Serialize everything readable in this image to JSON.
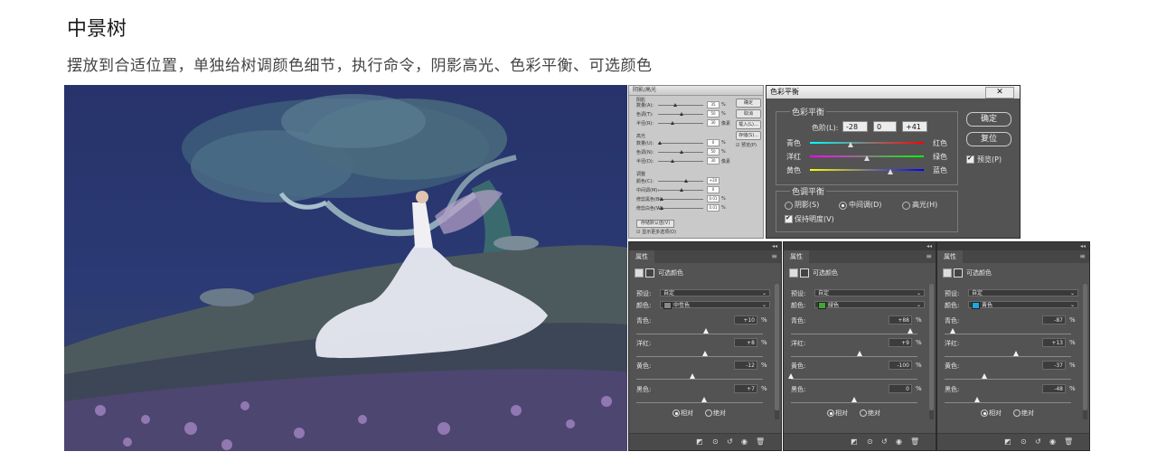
{
  "heading": "中景树",
  "description": "摆放到合适位置，单独给树调颜色细节，执行命令，阴影高光、色彩平衡、可选颜色",
  "shadows_highlights": {
    "title": "阴影/高光",
    "section_shadow": "阴影",
    "section_highlight": "高光",
    "section_adjust": "调整",
    "rows": [
      {
        "label": "数量(A):",
        "value": "35",
        "unit": "%"
      },
      {
        "label": "色调(T):",
        "value": "50",
        "unit": "%"
      },
      {
        "label": "半径(R):",
        "value": "30",
        "unit": "像素"
      },
      {
        "label": "数量(U):",
        "value": "0",
        "unit": "%"
      },
      {
        "label": "色调(N):",
        "value": "50",
        "unit": "%"
      },
      {
        "label": "半径(D):",
        "value": "30",
        "unit": "像素"
      },
      {
        "label": "颜色(C):",
        "value": "+20",
        "unit": ""
      },
      {
        "label": "中间调(M):",
        "value": "0",
        "unit": ""
      },
      {
        "label": "修剪黑色(B):",
        "value": "0.01",
        "unit": "%"
      },
      {
        "label": "修剪白色(W):",
        "value": "0.01",
        "unit": "%"
      }
    ],
    "buttons": [
      "确定",
      "取消",
      "载入(L)...",
      "存储(S)..."
    ],
    "preview_label": "预览(P)",
    "save_default": "存储默认值(V)",
    "more_options": "显示更多选项(O)"
  },
  "color_balance": {
    "window_title": "色彩平衡",
    "close_label": "✕",
    "group_title": "色彩平衡",
    "levels_label": "色阶(L):",
    "levels": [
      "-28",
      "0",
      "+41"
    ],
    "sliders": [
      {
        "left": "青色",
        "right": "红色",
        "value": -28
      },
      {
        "left": "洋红",
        "right": "绿色",
        "value": 0
      },
      {
        "left": "黄色",
        "right": "蓝色",
        "value": 41
      }
    ],
    "tone_title": "色调平衡",
    "tones": [
      "阴影(S)",
      "中间调(D)",
      "高光(H)"
    ],
    "tone_selected": 1,
    "preserve_label": "保持明度(V)",
    "ok_label": "确定",
    "reset_label": "复位",
    "preview_label": "预览(P)"
  },
  "properties_panels": [
    {
      "tab": "属性",
      "type_label": "可选颜色",
      "preset_label": "预设:",
      "preset_value": "自定",
      "color_label": "颜色:",
      "color_value": "中性色",
      "color_swatch": "#888888",
      "rows": [
        {
          "label": "青色:",
          "value": "+10",
          "frac": 0.55
        },
        {
          "label": "洋红:",
          "value": "+8",
          "frac": 0.54
        },
        {
          "label": "黄色:",
          "value": "-12",
          "frac": 0.44
        },
        {
          "label": "黑色:",
          "value": "+7",
          "frac": 0.535
        }
      ],
      "relative_label": "相对",
      "absolute_label": "绝对"
    },
    {
      "tab": "属性",
      "type_label": "可选颜色",
      "preset_label": "预设:",
      "preset_value": "自定",
      "color_label": "颜色:",
      "color_value": "绿色",
      "color_swatch": "#3fa535",
      "rows": [
        {
          "label": "青色:",
          "value": "+88",
          "frac": 0.94
        },
        {
          "label": "洋红:",
          "value": "+9",
          "frac": 0.545
        },
        {
          "label": "黄色:",
          "value": "-100",
          "frac": 0.0
        },
        {
          "label": "黑色:",
          "value": "0",
          "frac": 0.5
        }
      ],
      "relative_label": "相对",
      "absolute_label": "绝对"
    },
    {
      "tab": "属性",
      "type_label": "可选颜色",
      "preset_label": "预设:",
      "preset_value": "自定",
      "color_label": "颜色:",
      "color_value": "青色",
      "color_swatch": "#1ea6e0",
      "rows": [
        {
          "label": "青色:",
          "value": "-87",
          "frac": 0.065
        },
        {
          "label": "洋红:",
          "value": "+13",
          "frac": 0.565
        },
        {
          "label": "黄色:",
          "value": "-37",
          "frac": 0.315
        },
        {
          "label": "黑色:",
          "value": "-48",
          "frac": 0.26
        }
      ],
      "relative_label": "相对",
      "absolute_label": "绝对"
    }
  ],
  "panel_footer_icons": [
    "clip-to-layer-icon",
    "view-previous-icon",
    "reset-icon",
    "visibility-eye-icon",
    "trash-icon"
  ]
}
